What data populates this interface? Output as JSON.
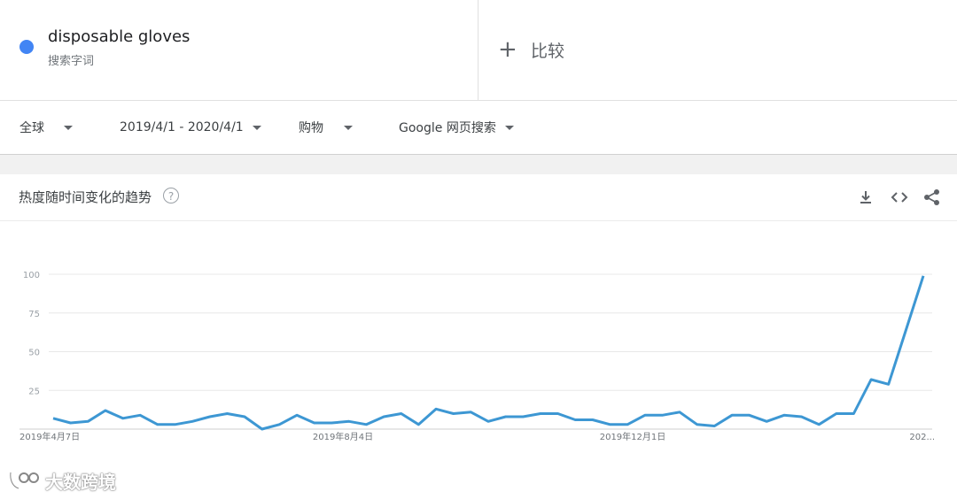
{
  "term": {
    "title": "disposable gloves",
    "subtitle": "搜索字词",
    "dot_color": "#4285f4"
  },
  "compare": {
    "icon": "plus-icon",
    "label": "比较"
  },
  "filters": [
    {
      "label": "全球"
    },
    {
      "label": "2019/4/1 - 2020/4/1"
    },
    {
      "label": "购物"
    },
    {
      "label": "Google 网页搜索"
    }
  ],
  "card": {
    "title": "热度随时间变化的趋势",
    "help_icon": "?",
    "icons": [
      "download-icon",
      "embed-code-icon",
      "share-icon"
    ]
  },
  "chart_data": {
    "type": "line",
    "series": [
      {
        "color": "#3d97d3",
        "values": [
          7,
          4,
          5,
          12,
          7,
          9,
          3,
          3,
          5,
          8,
          10,
          8,
          0,
          3,
          9,
          4,
          4,
          5,
          3,
          8,
          10,
          3,
          13,
          10,
          11,
          5,
          8,
          8,
          10,
          10,
          6,
          6,
          3,
          3,
          9,
          9,
          11,
          3,
          2,
          9,
          9,
          5,
          9,
          8,
          3,
          10,
          10,
          32,
          29,
          64,
          99
        ]
      }
    ],
    "x_tick_labels": [
      "2019年4月7日",
      "2019年8月4日",
      "2019年12月1日",
      "202..."
    ],
    "y_ticks": [
      25,
      50,
      75,
      100
    ],
    "ylim": [
      0,
      100
    ],
    "grid": true
  },
  "watermark": {
    "text": "大数跨境"
  }
}
